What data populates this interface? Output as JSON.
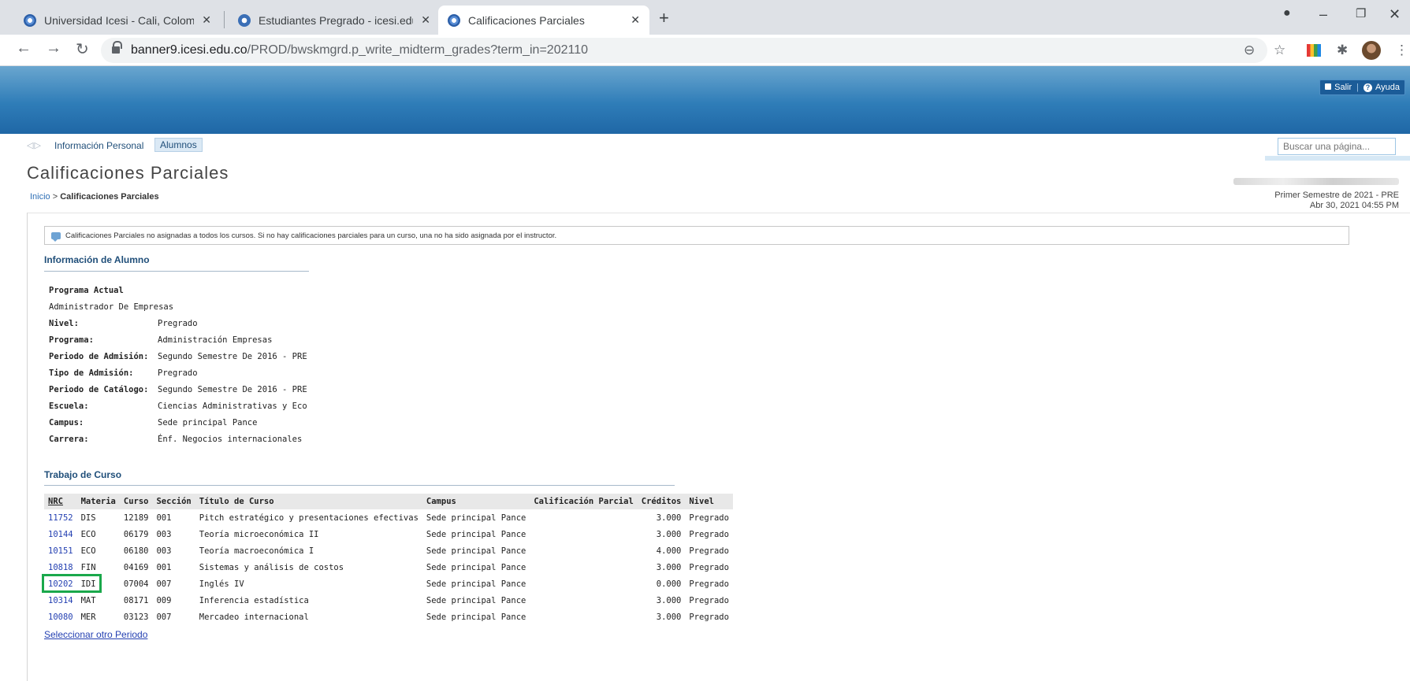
{
  "browser": {
    "tabs": [
      {
        "title": "Universidad Icesi - Cali, Colombia",
        "active": false
      },
      {
        "title": "Estudiantes Pregrado - icesi.edu.co",
        "active": false
      },
      {
        "title": "Calificaciones Parciales",
        "active": true
      }
    ],
    "url_host": "banner9.icesi.edu.co",
    "url_path": "/PROD/bwskmgrd.p_write_midterm_grades?term_in=202110"
  },
  "header": {
    "logout_label": "Salir",
    "help_label": "Ayuda"
  },
  "nav": {
    "personal_info": "Información Personal",
    "students": "Alumnos",
    "search_placeholder": "Buscar una página..."
  },
  "page": {
    "title": "Calificaciones Parciales",
    "breadcrumb_home": "Inicio",
    "breadcrumb_sep": " > ",
    "breadcrumb_current": "Calificaciones Parciales",
    "term": "Primer Semestre de 2021 - PRE",
    "datetime": "Abr 30, 2021 04:55 PM",
    "info_note": "Calificaciones Parciales no asignadas a todos los cursos. Si no hay calificaciones parciales para un curso, una no ha sido asignada por el instructor."
  },
  "student": {
    "section_title": "Información de Alumno",
    "current_program_label": "Programa Actual",
    "current_program_value": "Administrador De Empresas",
    "fields": [
      {
        "label": "Nivel:",
        "value": "Pregrado"
      },
      {
        "label": "Programa:",
        "value": "Administración Empresas"
      },
      {
        "label": "Periodo de Admisión:",
        "value": "Segundo Semestre De 2016 - PRE"
      },
      {
        "label": "Tipo de Admisión:",
        "value": "Pregrado"
      },
      {
        "label": "Periodo de Catálogo:",
        "value": "Segundo Semestre De 2016 - PRE"
      },
      {
        "label": "Escuela:",
        "value": "Ciencias Administrativas y Eco"
      },
      {
        "label": "Campus:",
        "value": "Sede principal Pance"
      },
      {
        "label": "Carrera:",
        "value": "Énf. Negocios internacionales"
      }
    ]
  },
  "courses": {
    "section_title": "Trabajo de Curso",
    "headers": [
      "NRC",
      "Materia",
      "Curso",
      "Sección",
      "Título de Curso",
      "Campus",
      "Calificación Parcial",
      "Créditos",
      "Nivel"
    ],
    "rows": [
      {
        "nrc": "11752",
        "materia": "DIS",
        "curso": "12189",
        "seccion": "001",
        "titulo": "Pitch estratégico y presentaciones efectivas",
        "campus": "Sede principal Pance",
        "calificacion": "",
        "creditos": "3.000",
        "nivel": "Pregrado"
      },
      {
        "nrc": "10144",
        "materia": "ECO",
        "curso": "06179",
        "seccion": "003",
        "titulo": "Teoría microeconómica II",
        "campus": "Sede principal Pance",
        "calificacion": "",
        "creditos": "3.000",
        "nivel": "Pregrado"
      },
      {
        "nrc": "10151",
        "materia": "ECO",
        "curso": "06180",
        "seccion": "003",
        "titulo": "Teoría macroeconómica I",
        "campus": "Sede principal Pance",
        "calificacion": "",
        "creditos": "4.000",
        "nivel": "Pregrado"
      },
      {
        "nrc": "10818",
        "materia": "FIN",
        "curso": "04169",
        "seccion": "001",
        "titulo": "Sistemas y análisis de costos",
        "campus": "Sede principal Pance",
        "calificacion": "",
        "creditos": "3.000",
        "nivel": "Pregrado"
      },
      {
        "nrc": "10202",
        "materia": "IDI",
        "curso": "07004",
        "seccion": "007",
        "titulo": "Inglés IV",
        "campus": "Sede principal Pance",
        "calificacion": "",
        "creditos": "0.000",
        "nivel": "Pregrado"
      },
      {
        "nrc": "10314",
        "materia": "MAT",
        "curso": "08171",
        "seccion": "009",
        "titulo": "Inferencia estadística",
        "campus": "Sede principal Pance",
        "calificacion": "",
        "creditos": "3.000",
        "nivel": "Pregrado"
      },
      {
        "nrc": "10080",
        "materia": "MER",
        "curso": "03123",
        "seccion": "007",
        "titulo": "Mercadeo internacional",
        "campus": "Sede principal Pance",
        "calificacion": "",
        "creditos": "3.000",
        "nivel": "Pregrado"
      }
    ],
    "other_period_link": "Seleccionar otro Periodo"
  },
  "colors": {
    "highlight": "#1aa84b",
    "link": "#2541b2",
    "banner": "#2f7db8"
  }
}
